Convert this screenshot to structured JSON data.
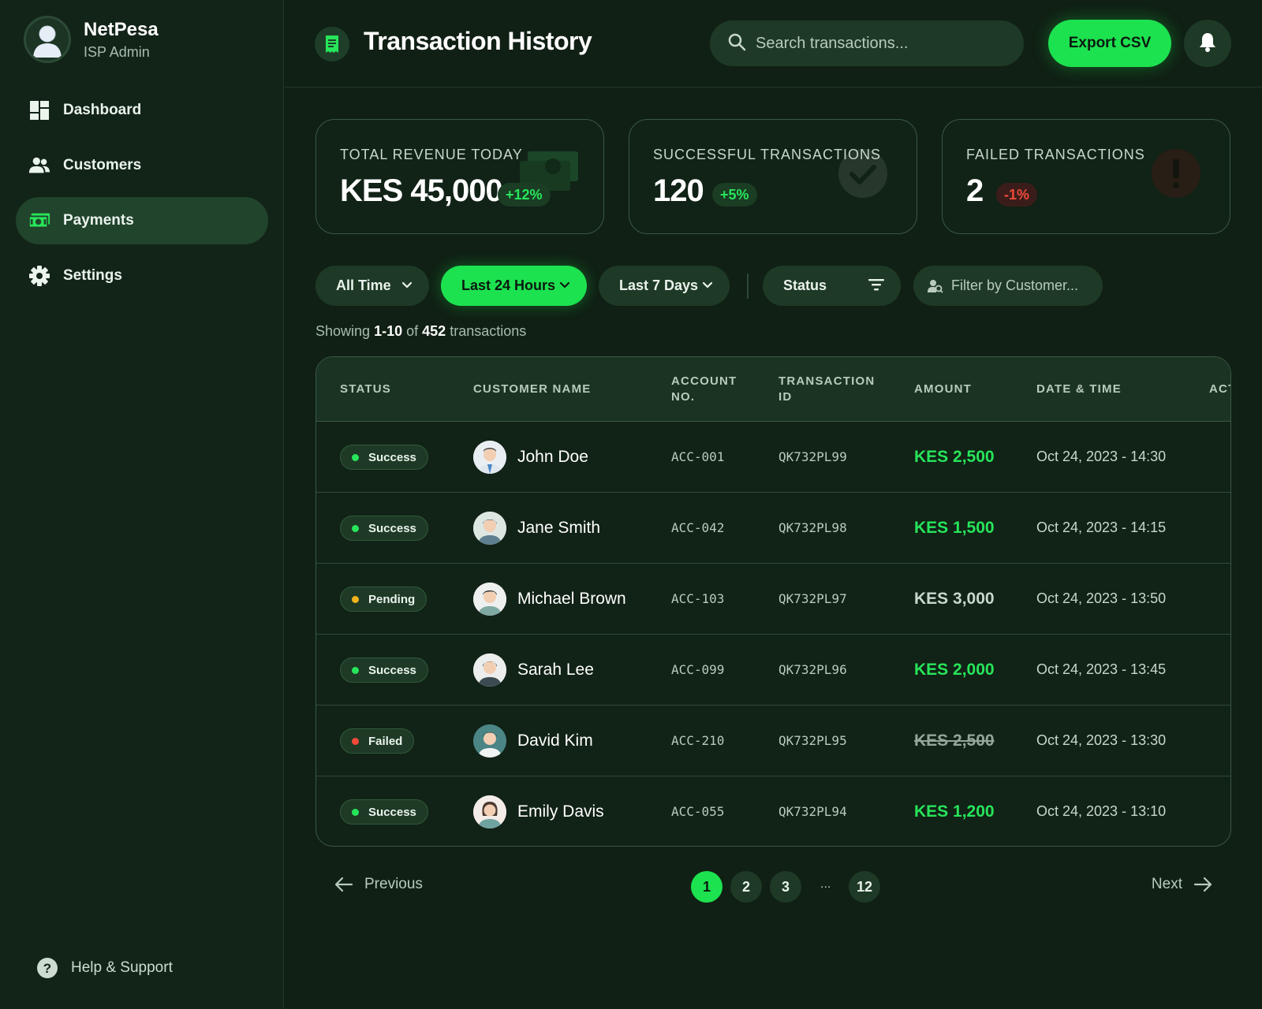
{
  "app": {
    "name": "NetPesa",
    "role": "ISP Admin"
  },
  "sidebar": {
    "items": [
      {
        "label": "Dashboard",
        "icon": "dashboard-icon",
        "active": false
      },
      {
        "label": "Customers",
        "icon": "users-icon",
        "active": false
      },
      {
        "label": "Payments",
        "icon": "payments-icon",
        "active": true
      },
      {
        "label": "Settings",
        "icon": "gear-icon",
        "active": false
      }
    ],
    "help_label": "Help & Support"
  },
  "header": {
    "title": "Transaction History",
    "search_placeholder": "Search transactions...",
    "export_label": "Export CSV"
  },
  "stats": [
    {
      "label": "TOTAL REVENUE TODAY",
      "value": "KES 45,000",
      "delta": "+12%",
      "trend": "up",
      "icon": "money-icon"
    },
    {
      "label": "SUCCESSFUL TRANSACTIONS",
      "value": "120",
      "delta": "+5%",
      "trend": "up",
      "icon": "check-circle-icon"
    },
    {
      "label": "FAILED TRANSACTIONS",
      "value": "2",
      "delta": "-1%",
      "trend": "down",
      "icon": "alert-circle-icon"
    }
  ],
  "filters": {
    "all_time": "All Time",
    "last_24h": "Last 24 Hours",
    "last_7d": "Last 7 Days",
    "status": "Status",
    "customer_placeholder": "Filter by Customer..."
  },
  "summary": {
    "prefix": "Showing",
    "range": "1-10",
    "of": "of",
    "total": "452",
    "suffix": "transactions"
  },
  "table": {
    "headers": {
      "status": "STATUS",
      "customer": "CUSTOMER NAME",
      "account_1": "ACCOUNT",
      "account_2": "NO.",
      "txn_1": "TRANSACTION",
      "txn_2": "ID",
      "amount": "AMOUNT",
      "date": "DATE & TIME",
      "action": "ACT"
    },
    "rows": [
      {
        "status": "Success",
        "name": "John Doe",
        "account": "ACC-001",
        "txn": "QK732PL99",
        "amount": "KES 2,500",
        "date": "Oct 24, 2023 - 14:30"
      },
      {
        "status": "Success",
        "name": "Jane Smith",
        "account": "ACC-042",
        "txn": "QK732PL98",
        "amount": "KES 1,500",
        "date": "Oct 24, 2023 - 14:15"
      },
      {
        "status": "Pending",
        "name": "Michael Brown",
        "account": "ACC-103",
        "txn": "QK732PL97",
        "amount": "KES 3,000",
        "date": "Oct 24, 2023 - 13:50"
      },
      {
        "status": "Success",
        "name": "Sarah Lee",
        "account": "ACC-099",
        "txn": "QK732PL96",
        "amount": "KES 2,000",
        "date": "Oct 24, 2023 - 13:45"
      },
      {
        "status": "Failed",
        "name": "David Kim",
        "account": "ACC-210",
        "txn": "QK732PL95",
        "amount": "KES 2,500",
        "date": "Oct 24, 2023 - 13:30"
      },
      {
        "status": "Success",
        "name": "Emily Davis",
        "account": "ACC-055",
        "txn": "QK732PL94",
        "amount": "KES 1,200",
        "date": "Oct 24, 2023 - 13:10"
      }
    ]
  },
  "pagination": {
    "previous": "Previous",
    "next": "Next",
    "pages": [
      "1",
      "2",
      "3",
      "12"
    ],
    "ellipsis": "...",
    "current": "1"
  },
  "colors": {
    "accent": "#1de24f",
    "background": "#102014",
    "success": "#27e55a",
    "pending": "#f2b21c",
    "failed": "#f04a3a"
  }
}
